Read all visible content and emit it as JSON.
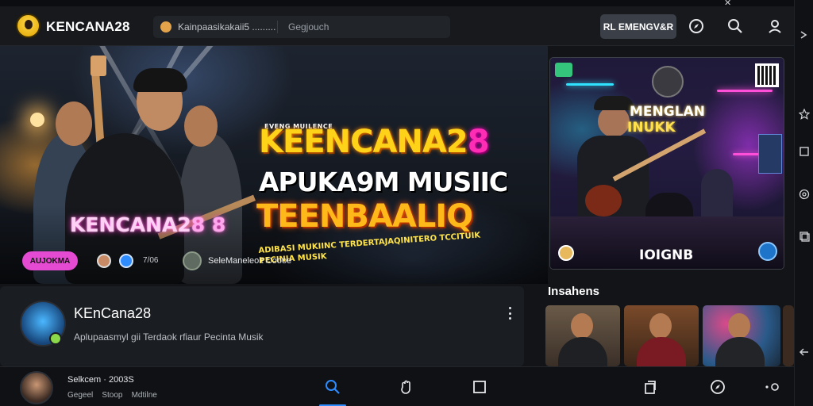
{
  "header": {
    "brand": "KENCANA28",
    "search_context": "Kainpaasikakaii5 .........",
    "search_placeholder": "Gegjouch",
    "action_button": "RL EMENGV&R"
  },
  "hero": {
    "small_caption": "EVENG MUILENCE",
    "title_main": "KEENCANA2",
    "title_digit": "8",
    "title_line2": "APUKA9M MUSIIC",
    "title_line3": "TEENBAALIQ",
    "tagline_1": "ADIBASI MUKIINC TERDERTAJAQINITERO TCCITUIK",
    "tagline_2": "PECINIA MUSIK",
    "brand_overlay_main": "KENCANA2",
    "brand_overlay_digit": "8 8",
    "pill_label": "AUJOKMA",
    "count": "7/06",
    "channel_line": "SeleManeleolt Coooe"
  },
  "poster": {
    "title_line1": "MENGLAN",
    "title_line2": "INUKK",
    "bottom_text": "IOIGNB"
  },
  "channel": {
    "name": "KEnCana28",
    "description": "Aplupaasmyl gii Terdaok rfiaur Pecinta Musik"
  },
  "highlights": {
    "title": "Insahens"
  },
  "bottom_bar": {
    "user_name": "Selkcem  ·  2003S",
    "links": "Gegeel    Stoop    Mdtilne"
  },
  "colors": {
    "accent_blue": "#2f8cff",
    "pill_pink": "#e54ad2",
    "title_gold": "#ffd21a",
    "title_magenta": "#ff2db4"
  },
  "icons": {
    "header": [
      "compass-icon",
      "search-icon",
      "user-icon"
    ],
    "sidebar": [
      "chevron-right-icon",
      "star-icon",
      "square-icon",
      "at-sign-icon",
      "layers-icon",
      "back-arrow-icon"
    ],
    "bottom_nav": [
      "search-icon",
      "hand-icon",
      "square-icon",
      "copy-icon",
      "compass-icon",
      "more-icon"
    ]
  }
}
